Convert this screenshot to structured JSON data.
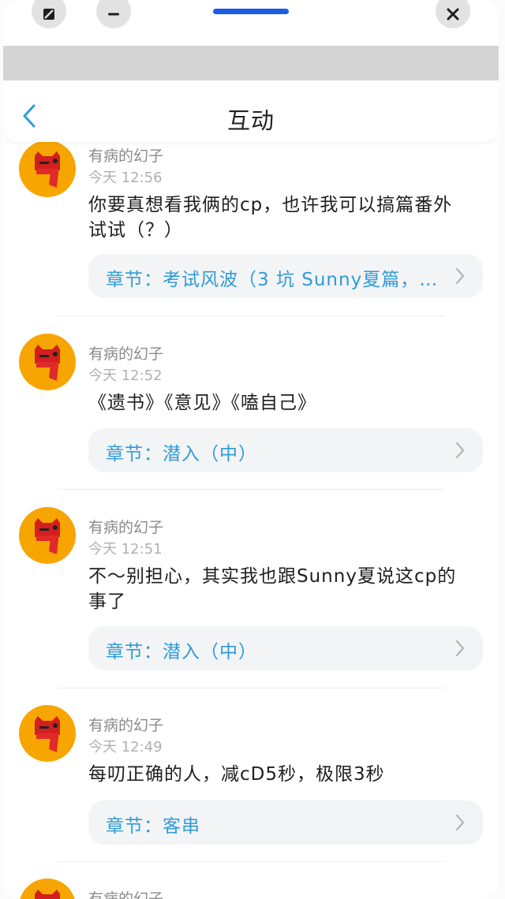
{
  "header": {
    "title": "互动"
  },
  "comments": [
    {
      "username": "有病的幻子",
      "time": "今天 12:56",
      "text": "你要真想看我俩的cp，也许我可以搞篇番外\n试试（？）",
      "chapter": "章节：考试风波（3 坑 Sunny夏篇，…"
    },
    {
      "username": "有病的幻子",
      "time": "今天 12:52",
      "text": "《遗书》《意见》《嗑自己》",
      "chapter": "章节：潜入（中）"
    },
    {
      "username": "有病的幻子",
      "time": "今天 12:51",
      "text": "不～别担心，其实我也跟Sunny夏说这cp的\n事了",
      "chapter": "章节：潜入（中）"
    },
    {
      "username": "有病的幻子",
      "time": "今天 12:49",
      "text": "每叨正确的人，减cD5秒，极限3秒",
      "chapter": "章节：客串"
    },
    {
      "username": "有病的幻子"
    }
  ],
  "colors": {
    "accent_blue": "#1a5ce6",
    "chapter_link": "#2f9bd6",
    "avatar_bg": "#f7a500"
  },
  "icons": {
    "window_left": "maximize-icon",
    "window_minimize": "minimize-icon",
    "window_close": "close-icon",
    "back": "chevron-left-icon",
    "chapter_arrow": "chevron-right-icon"
  }
}
